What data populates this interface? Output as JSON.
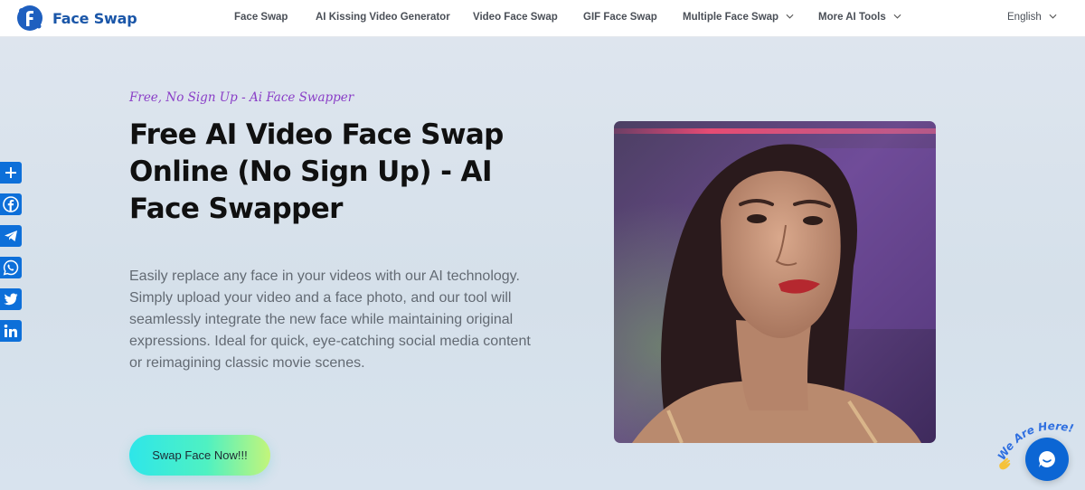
{
  "nav": {
    "brand": "Face Swap",
    "links": [
      {
        "label": "Face Swap"
      },
      {
        "label": "AI Kissing Video Generator"
      },
      {
        "label": "Video Face Swap"
      },
      {
        "label": "GIF Face Swap"
      },
      {
        "label": "Multiple Face Swap"
      },
      {
        "label": "More AI Tools"
      }
    ],
    "language": "English"
  },
  "social": [
    "share-icon",
    "facebook-icon",
    "telegram-icon",
    "whatsapp-icon",
    "twitter-icon",
    "linkedin-icon"
  ],
  "hero": {
    "tagline": "Free, No Sign Up - Ai Face Swapper",
    "title": "Free AI Video Face Swap Online (No Sign Up) - AI Face Swapper",
    "description": "Easily replace any face in your videos with our AI technology. Simply upload your video and a face photo, and our tool will seamlessly integrate the new face while maintaining original expressions. Ideal for quick, eye-catching social media content or reimagining classic movie scenes.",
    "cta_label": "Swap Face Now!!!"
  },
  "chat": {
    "badge": "We Are Here!"
  },
  "colors": {
    "brand": "#1a56a8",
    "accent_tagline": "#8a3ec7",
    "social": "#0d6fd9",
    "chat": "#0c66d4"
  }
}
